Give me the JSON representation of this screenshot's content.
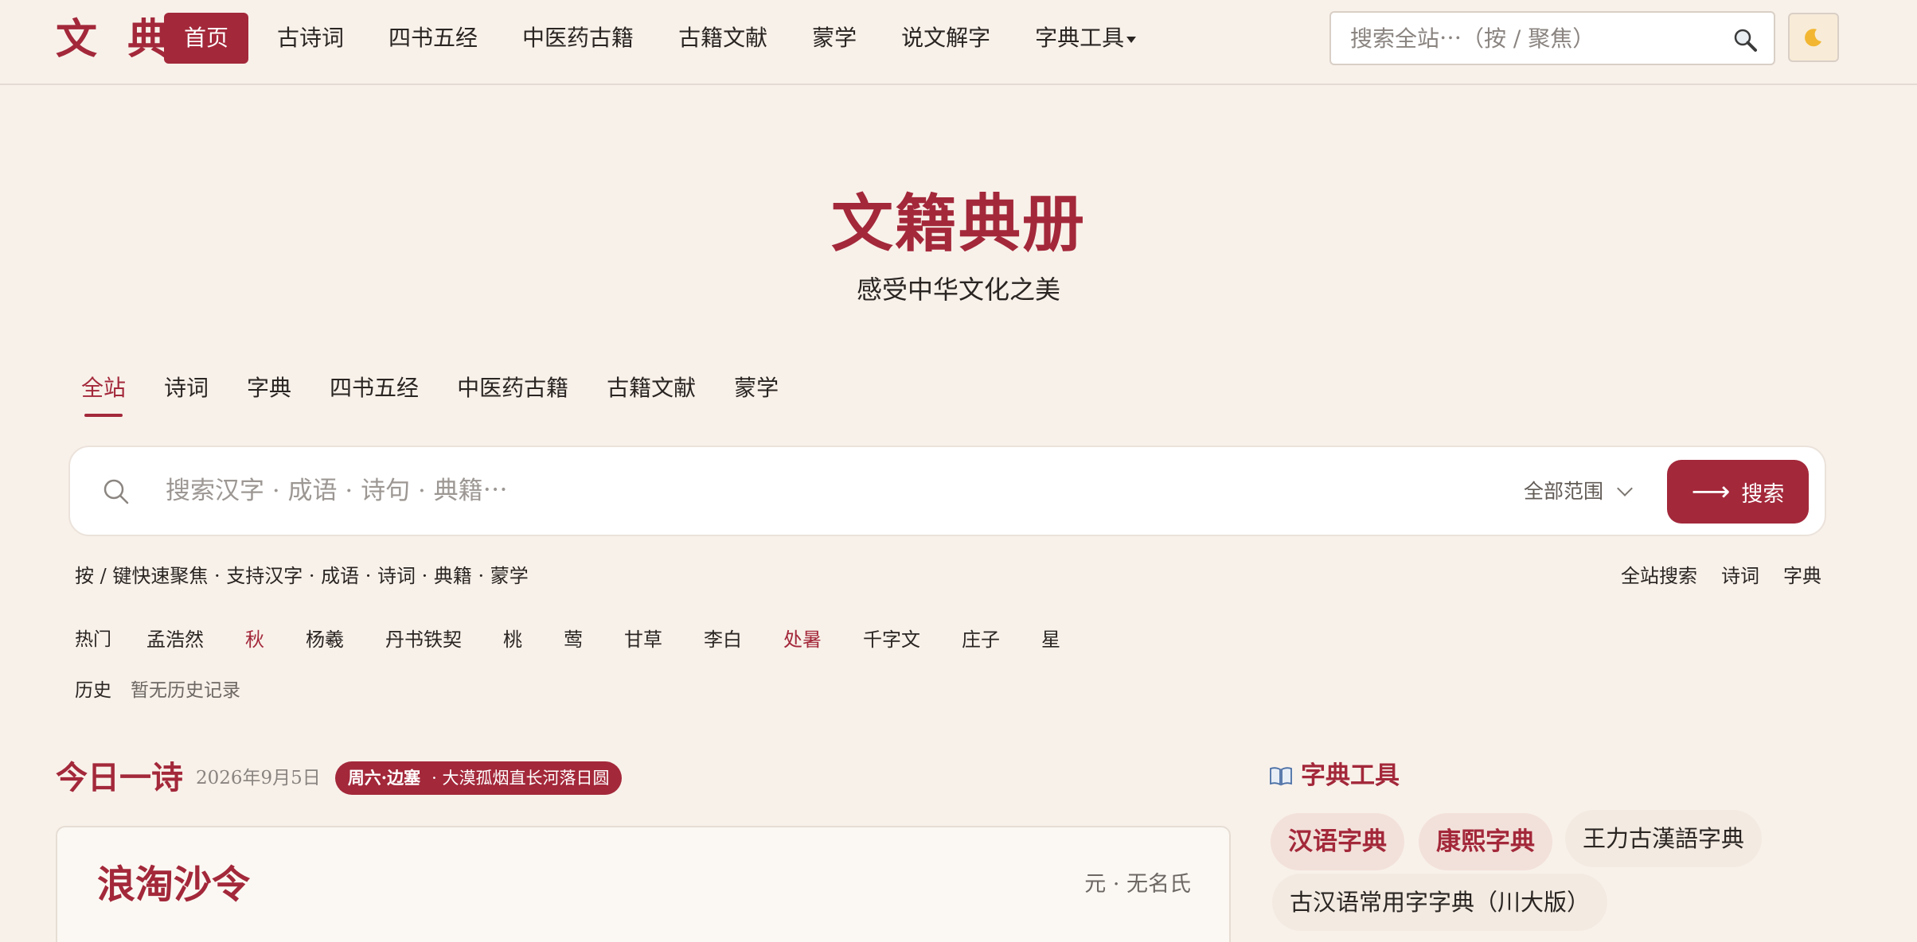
{
  "header": {
    "logo": "文 典",
    "nav": [
      "首页",
      "古诗词",
      "四书五经",
      "中医药古籍",
      "古籍文献",
      "蒙学",
      "说文解字",
      "字典工具"
    ],
    "search_placeholder": "搜索全站⋯（按 / 聚焦）",
    "theme_toggle_icon": "moon-icon"
  },
  "hero": {
    "title": "文籍典册",
    "subtitle": "感受中华文化之美"
  },
  "scope_tabs": [
    "全站",
    "诗词",
    "字典",
    "四书五经",
    "中医药古籍",
    "古籍文献",
    "蒙学"
  ],
  "search": {
    "placeholder": "搜索汉字 · 成语 · 诗句 · 典籍⋯",
    "range": "全部范围",
    "button": "搜索",
    "hint": "按 / 键快速聚焦 · 支持汉字 · 成语 · 诗词 · 典籍 · 蒙学",
    "quick_links": [
      "全站搜索",
      "诗词",
      "字典"
    ]
  },
  "hot": {
    "label": "热门",
    "items": [
      "孟浩然",
      "秋",
      "杨羲",
      "丹书铁契",
      "桃",
      "莺",
      "甘草",
      "李白",
      "处暑",
      "千字文",
      "庄子",
      "星"
    ],
    "highlighted": [
      "秋",
      "处暑"
    ]
  },
  "history": {
    "label": "历史",
    "empty": "暂无历史记录"
  },
  "daily": {
    "title": "今日一诗",
    "date": "2026年9月5日",
    "badge_bold": "周六·边塞",
    "badge_text": "· 大漠孤烟直长河落日圆",
    "poem_title": "浪淘沙令",
    "poem_author": "元 · 无名氏"
  },
  "tools": {
    "title": "字典工具",
    "items": [
      "汉语字典",
      "康熙字典",
      "王力古漢語字典",
      "古汉语常用字字典（川大版）"
    ]
  },
  "colors": {
    "accent": "#a3283a",
    "background": "#f8f1ea"
  }
}
